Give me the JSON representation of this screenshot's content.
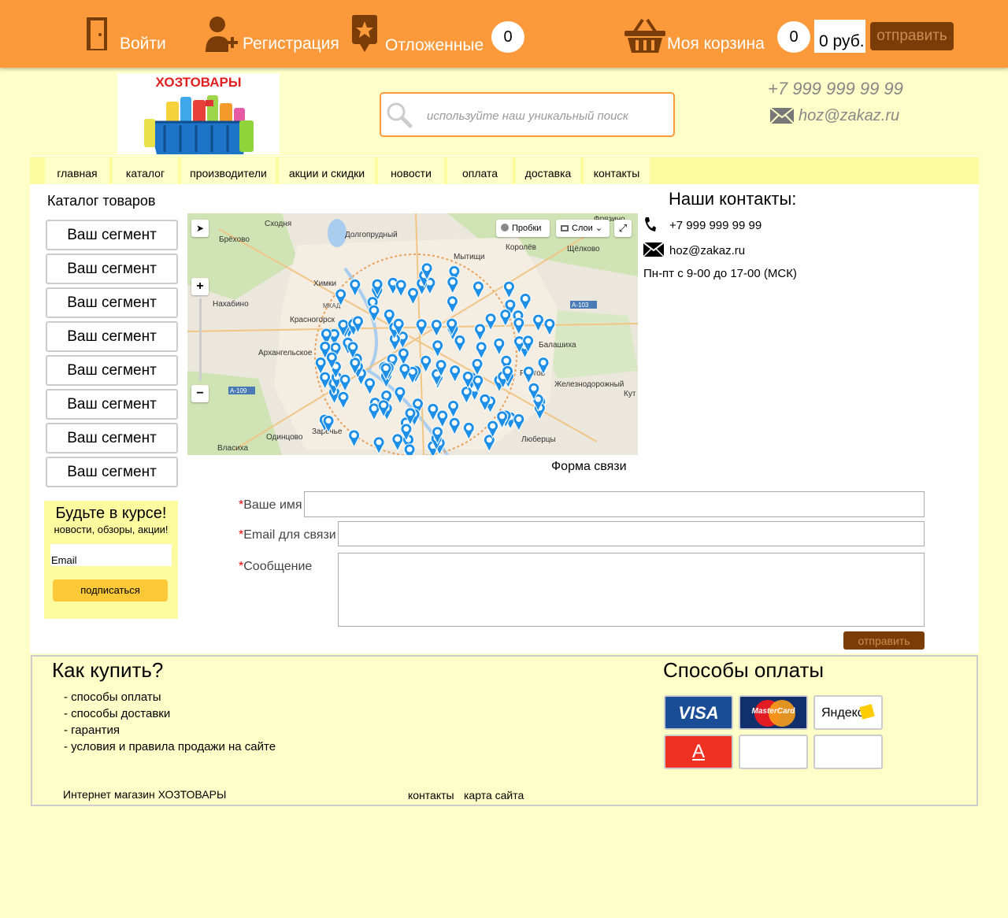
{
  "topbar": {
    "login": "Войти",
    "register": "Регистрация",
    "deferred": "Отложенные",
    "deferred_count": "0",
    "cart": "Моя корзина",
    "cart_count": "0",
    "cart_total": "0 руб.",
    "send": "отправить"
  },
  "header": {
    "logo_text": "ХОЗТОВАРЫ",
    "search_placeholder": "используйте наш уникальный поиск",
    "phone": "+7 999 999 99 99",
    "email": "hoz@zakaz.ru"
  },
  "nav": [
    "главная",
    "каталог",
    "производители",
    "акции и скидки",
    "новости",
    "оплата",
    "доставка",
    "контакты"
  ],
  "catalog": {
    "title": "Каталог товаров",
    "segments": [
      "Ваш сегмент",
      "Ваш сегмент",
      "Ваш сегмент",
      "Ваш сегмент",
      "Ваш сегмент",
      "Ваш сегмент",
      "Ваш сегмент",
      "Ваш сегмент"
    ]
  },
  "subscribe": {
    "title": "Будьте в курсе!",
    "subtitle": "новости, обзоры, акции!",
    "input_value": "Email",
    "button": "подписаться"
  },
  "map": {
    "traffic_label": "Пробки",
    "layers_label": "Слои",
    "places": [
      "Сходня",
      "Брёхово",
      "Долгопрудный",
      "Мытищи",
      "Королёв",
      "Щёлково",
      "Химки",
      "Нахабино",
      "Красногорск",
      "Архангельское",
      "Балашиха",
      "Реутов",
      "Железнодорожный",
      "Одинцово",
      "Заречье",
      "Власиха",
      "Люберцы",
      "Фрязино",
      "Кут"
    ],
    "roads": [
      "А-103",
      "А-109",
      "МКАД"
    ],
    "zoom_in": "+",
    "zoom_out": "−"
  },
  "contacts": {
    "title": "Наши контакты:",
    "phone": "+7 999 999 99 99",
    "email": "hoz@zakaz.ru",
    "hours": "Пн-пт с 9-00 до 17-00 (МСК)"
  },
  "feedback": {
    "title": "Форма связи",
    "name_label": "Ваше имя",
    "email_label": "Email для связи",
    "message_label": "Сообщение",
    "required_mark": "*",
    "send": "отправить"
  },
  "footer": {
    "how_title": "Как купить?",
    "links": [
      "- способы оплаты",
      "- способы доставки",
      "- гарантия",
      "- условия и правила продажи на сайте"
    ],
    "pay_title": "Способы оплаты",
    "cards": [
      "VISA",
      "MasterCard",
      "Яндекс",
      "А"
    ],
    "shop_name": "Интернет магазин ХОЗТОВАРЫ",
    "contacts_link": "контакты",
    "sitemap_link": "карта сайта"
  },
  "colors": {
    "topbar": "#fc9a3b",
    "page_bg": "#fefec8",
    "nav_strip": "#fdfba0",
    "button_dark": "#7a3d08",
    "subscribe_button": "#fbc838",
    "map_pin": "#1e8fe6"
  }
}
